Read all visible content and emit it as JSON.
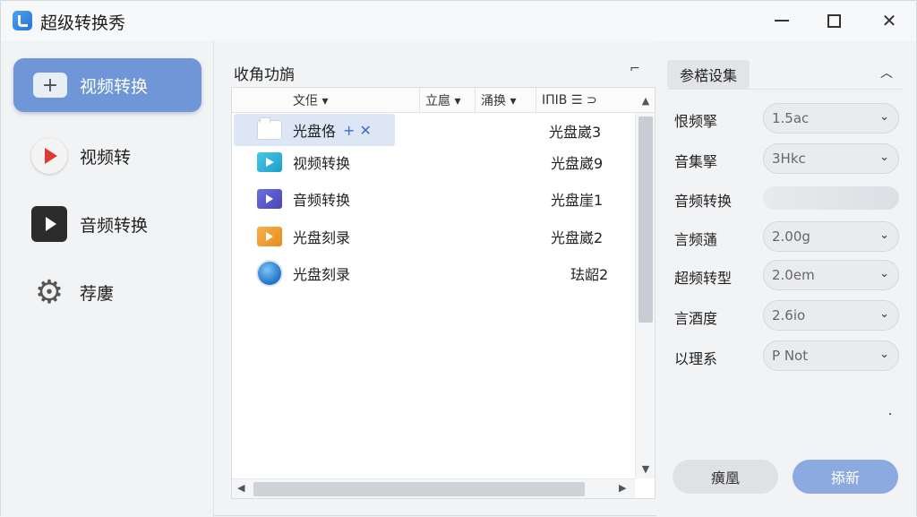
{
  "app": {
    "title": "超级转换秀"
  },
  "window_controls": {
    "minimize": "minimize",
    "maximize": "maximize",
    "close": "✕"
  },
  "sidebar": {
    "items": [
      {
        "label": "视频转换",
        "icon": "plus-icon",
        "active": true
      },
      {
        "label": "视频转",
        "icon": "video-play-icon",
        "active": false
      },
      {
        "label": "音频转换",
        "icon": "film-play-icon",
        "active": false
      },
      {
        "label": "荐廔",
        "icon": "gear-icon",
        "active": false
      }
    ]
  },
  "file_panel": {
    "title": "收角功旓",
    "pin_glyph": "⌐",
    "columns": [
      "文佢 ▾",
      "立扈 ▾",
      "涌换 ▾",
      "ΙΠΙΒ ☰ ⊃"
    ],
    "sort_glyph": "▲",
    "rows": [
      {
        "name": "光盘佫",
        "actions": "+ ✕",
        "value": "光盘崴3",
        "icon": "folder-icon",
        "selected": true
      },
      {
        "name": "视频转换",
        "actions": "",
        "value": "光盘崴9",
        "icon": "video-file-icon",
        "selected": false
      },
      {
        "name": "音频转换",
        "actions": "",
        "value": "光盘崖1",
        "icon": "audio-file-icon",
        "selected": false
      },
      {
        "name": "光盘刻录",
        "actions": "",
        "value": "光盘崴2",
        "icon": "disc-file-icon",
        "selected": false
      },
      {
        "name": "光盘刻录",
        "actions": "",
        "value": "珐龆2",
        "icon": "globe-icon",
        "selected": false
      }
    ]
  },
  "params": {
    "tab_label": "参楛设集",
    "collapse_glyph": "︿",
    "items": [
      {
        "label": "恨频掔",
        "value": "1.5ac",
        "type": "select"
      },
      {
        "label": "音集掔",
        "value": "3Hkc",
        "type": "select"
      },
      {
        "label": "音频转换",
        "value": "",
        "type": "toggle"
      },
      {
        "label": "言频蓪",
        "value": "2.00g",
        "type": "select"
      },
      {
        "label": "超频转型",
        "value": "2.0em",
        "type": "select"
      },
      {
        "label": "言酒度",
        "value": "2.6io",
        "type": "select"
      },
      {
        "label": "以理系",
        "value": "P Not",
        "type": "select"
      }
    ],
    "cancel_label": "癀凰",
    "ok_label": "掭新"
  },
  "colors": {
    "accent": "#6f96d6",
    "ok_button": "#8aaae0",
    "selection": "#dde6f4"
  }
}
